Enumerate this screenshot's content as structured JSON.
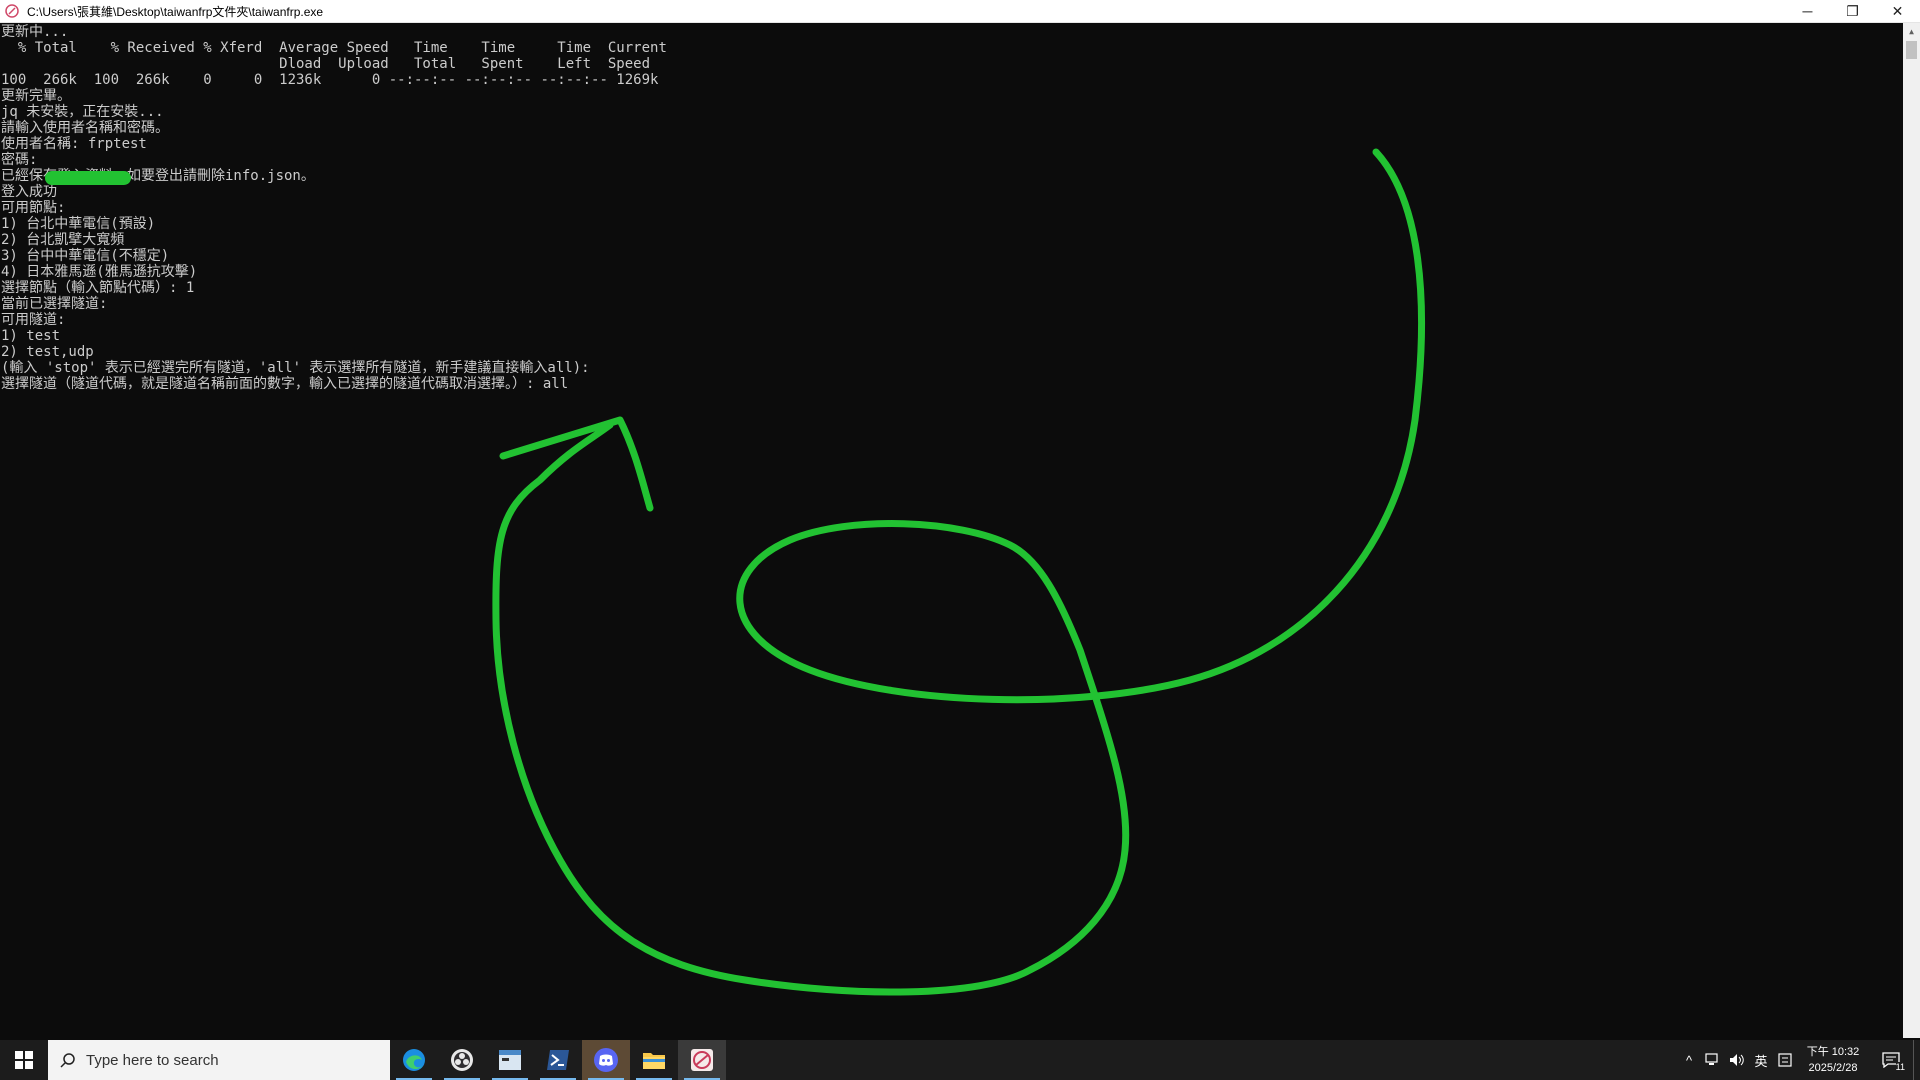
{
  "window": {
    "title": "C:\\Users\\張萁維\\Desktop\\taiwanfrp文件夾\\taiwanfrp.exe",
    "minimize": "─",
    "maximize": "❐",
    "close": "✕"
  },
  "console": {
    "lines": [
      "更新中...",
      "  % Total    % Received % Xferd  Average Speed   Time    Time     Time  Current",
      "                                 Dload  Upload   Total   Spent    Left  Speed",
      "100  266k  100  266k    0     0  1236k      0 --:--:-- --:--:-- --:--:-- 1269k",
      "更新完畢。",
      "jq 未安裝，正在安裝...",
      "請輸入使用者名稱和密碼。",
      "使用者名稱: frptest",
      "密碼:",
      "已經保存登入資料，如要登出請刪除info.json。",
      "登入成功",
      "可用節點:",
      "1) 台北中華電信(預設)",
      "2) 台北凱擘大寬頻",
      "3) 台中中華電信(不穩定)",
      "4) 日本雅馬遜(雅馬遜抗攻擊)",
      "選擇節點（輸入節點代碼）: 1",
      "當前已選擇隧道:",
      "可用隧道:",
      "1) test",
      "2) test,udp",
      "(輸入 'stop' 表示已經選完所有隧道，'all' 表示選擇所有隧道，新手建議直接輸入all):",
      "選擇隧道（隧道代碼，就是隧道名稱前面的數字，輸入已選擇的隧道代碼取消選擇。）: all"
    ]
  },
  "annotation": {
    "stroke_color": "#22c232"
  },
  "taskbar": {
    "search_placeholder": "Type here to search",
    "apps": [
      "edge-icon",
      "obs-icon",
      "terminal-icon",
      "powershell-icon",
      "discord-icon",
      "file-explorer-icon",
      "taiwanfrp-icon"
    ],
    "tray": {
      "chevron": "^",
      "ime": "英",
      "time": "下午 10:32",
      "date": "2025/2/28",
      "notification_count": "11"
    }
  }
}
